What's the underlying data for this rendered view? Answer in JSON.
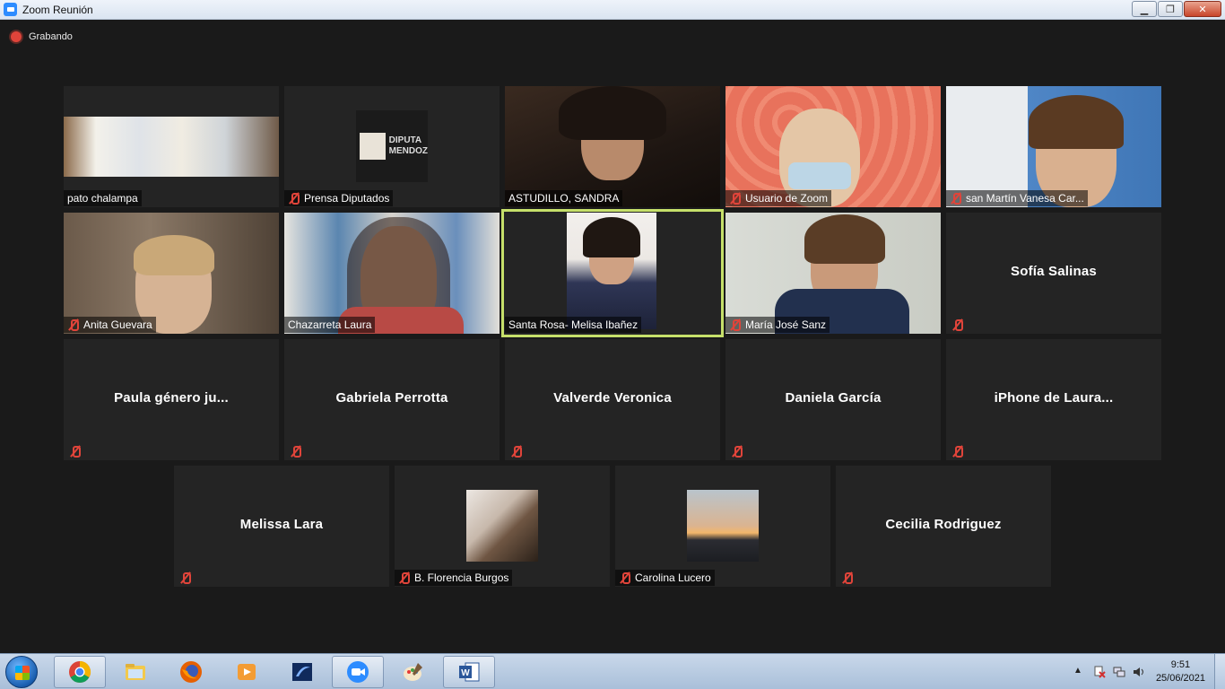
{
  "window": {
    "title": "Zoom Reunión"
  },
  "recording": {
    "label": "Grabando"
  },
  "tiles": [
    {
      "label": "pato chalampa",
      "muted": false,
      "kind": "panorama"
    },
    {
      "label": "Prensa Diputados",
      "muted": true,
      "kind": "logo",
      "logo_text": [
        "DIPUTA",
        "MENDOZ"
      ]
    },
    {
      "label": "ASTUDILLO, SANDRA",
      "muted": false,
      "kind": "video"
    },
    {
      "label": "Usuario de Zoom",
      "muted": true,
      "kind": "video"
    },
    {
      "label": "san Martín Vanesa Car...",
      "muted": true,
      "kind": "video"
    },
    {
      "label": "Anita Guevara",
      "muted": true,
      "kind": "video"
    },
    {
      "label": "Chazarreta Laura",
      "muted": false,
      "kind": "video"
    },
    {
      "label": "Santa Rosa- Melisa Ibañez",
      "muted": false,
      "kind": "video",
      "active_speaker": true
    },
    {
      "label": "María José Sanz",
      "muted": true,
      "kind": "video"
    },
    {
      "name": "Sofía Salinas",
      "muted": true,
      "kind": "name"
    },
    {
      "name": "Paula género ju...",
      "muted": true,
      "kind": "name"
    },
    {
      "name": "Gabriela Perrotta",
      "muted": true,
      "kind": "name"
    },
    {
      "name": "Valverde Veronica",
      "muted": true,
      "kind": "name"
    },
    {
      "name": "Daniela García",
      "muted": true,
      "kind": "name"
    },
    {
      "name": "iPhone de Laura...",
      "muted": true,
      "kind": "name"
    },
    {
      "name": "Melissa Lara",
      "muted": true,
      "kind": "name"
    },
    {
      "label": "B. Florencia Burgos",
      "muted": true,
      "kind": "photo"
    },
    {
      "label": "Carolina Lucero",
      "muted": true,
      "kind": "photo"
    },
    {
      "name": "Cecilia Rodriguez",
      "muted": true,
      "kind": "name"
    }
  ],
  "taskbar": {
    "apps": [
      "chrome-icon",
      "explorer-icon",
      "firefox-icon",
      "media-player-icon",
      "app-icon",
      "zoom-icon",
      "paint-icon",
      "word-icon"
    ],
    "clock": {
      "time": "9:51",
      "date": "25/06/2021"
    }
  },
  "colors": {
    "active_speaker": "#c6e06a",
    "mute": "#e0443a",
    "tile_bg": "#242424"
  }
}
